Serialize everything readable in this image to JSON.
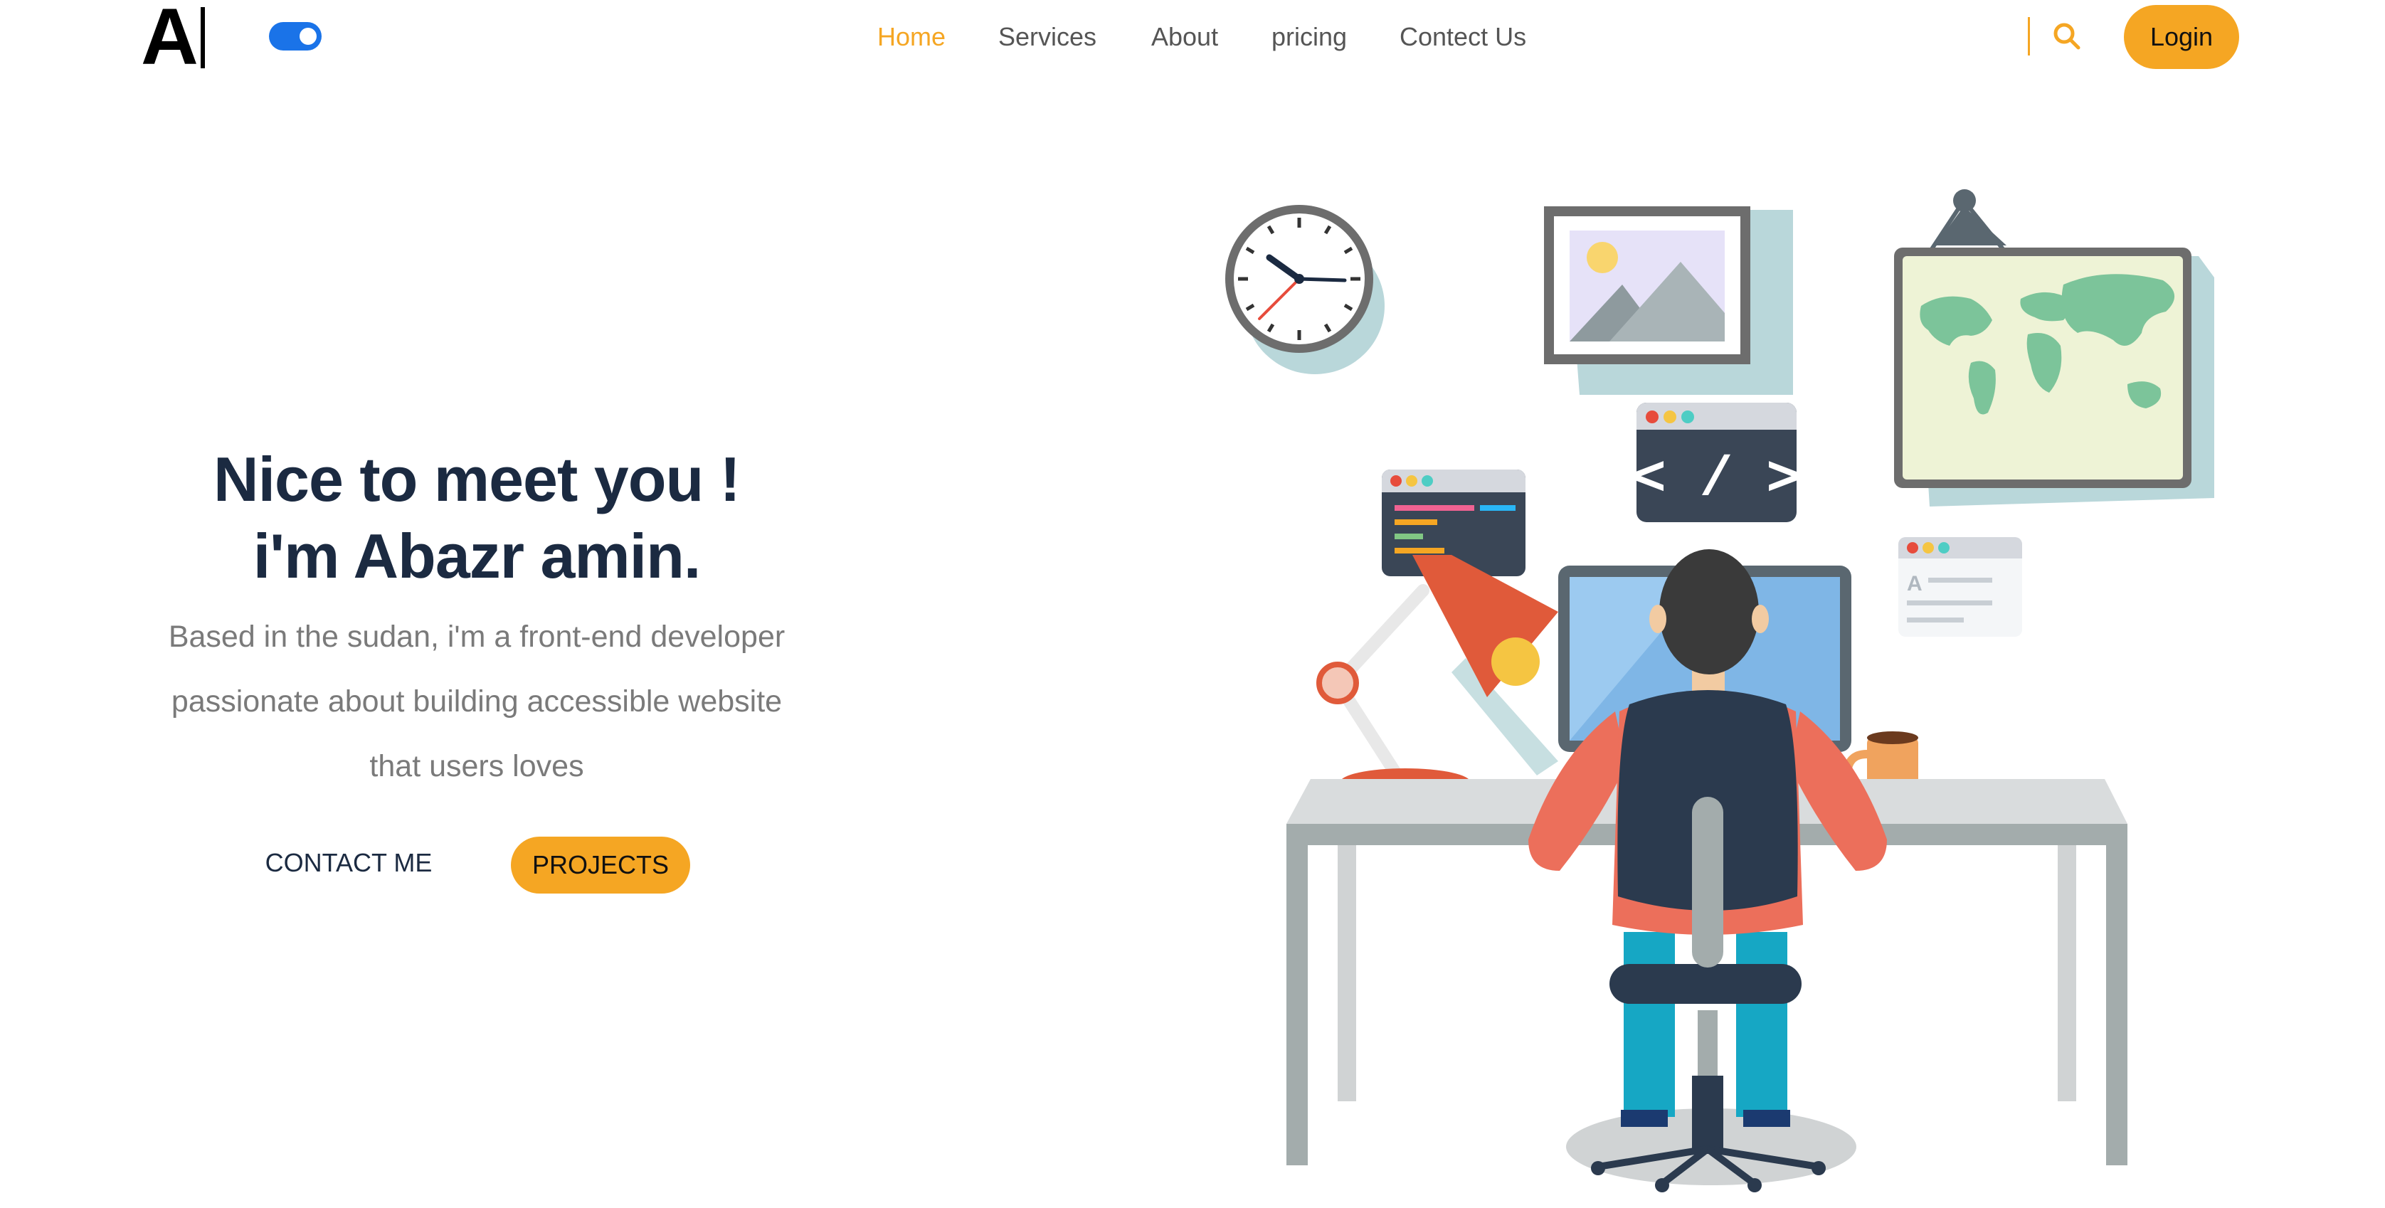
{
  "header": {
    "logo_text": "A",
    "theme_toggle": {
      "state": "on",
      "color": "#1a73e8"
    },
    "nav": [
      {
        "label": "Home",
        "active": true
      },
      {
        "label": "Services",
        "active": false
      },
      {
        "label": "About",
        "active": false
      },
      {
        "label": "pricing",
        "active": false
      },
      {
        "label": "Contect Us",
        "active": false
      }
    ],
    "search_icon": "search-icon",
    "login_label": "Login"
  },
  "hero": {
    "title_line1": "Nice to meet you !",
    "title_line2": "i'm Abazr amin.",
    "desc_line1": "Based in the sudan, i'm a front-end developer",
    "desc_line2": "passionate about building accessible website",
    "desc_line3": "that users loves",
    "contact_label": "CONTACT ME",
    "projects_label": "PROJECTS"
  },
  "illustration": {
    "code_window_symbol": "< / >",
    "card_letter": "A"
  },
  "colors": {
    "accent": "#f5a623",
    "title": "#1b2a41",
    "body_text": "#7a7a7a",
    "toggle": "#1a73e8"
  }
}
